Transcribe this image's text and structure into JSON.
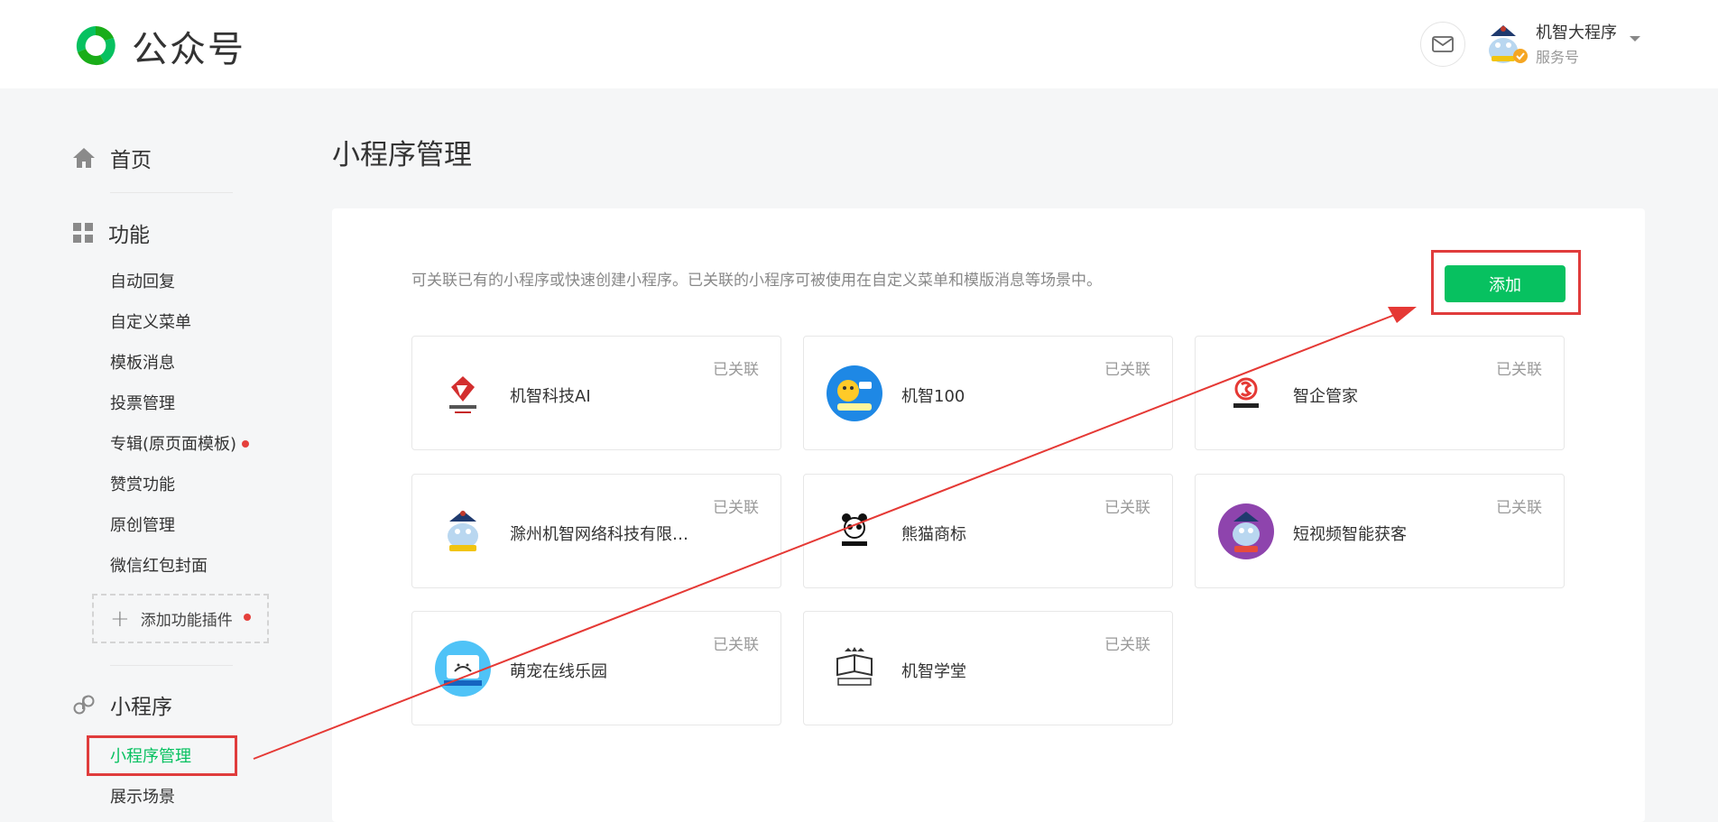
{
  "header": {
    "app_name": "公众号",
    "account_name": "机智大程序",
    "account_type": "服务号"
  },
  "sidebar": {
    "home": "首页",
    "features": {
      "label": "功能",
      "items": [
        "自动回复",
        "自定义菜单",
        "模板消息",
        "投票管理",
        "专辑(原页面模板)",
        "赞赏功能",
        "原创管理",
        "微信红包封面"
      ]
    },
    "add_plugin": "添加功能插件",
    "miniprogram": {
      "label": "小程序",
      "items": [
        "小程序管理",
        "展示场景"
      ]
    }
  },
  "main": {
    "title": "小程序管理",
    "description": "可关联已有的小程序或快速创建小程序。已关联的小程序可被使用在自定义菜单和模版消息等场景中。",
    "add_button": "添加",
    "cards": [
      {
        "name": "机智科技AI",
        "status": "已关联",
        "icon": "jizhi-keji-logo"
      },
      {
        "name": "机智100",
        "status": "已关联",
        "icon": "jizhi100-logo"
      },
      {
        "name": "智企管家",
        "status": "已关联",
        "icon": "zhiqi-guanjia-logo"
      },
      {
        "name": "滁州机智网络科技有限…",
        "status": "已关联",
        "icon": "chuzhou-jizhi-logo"
      },
      {
        "name": "熊猫商标",
        "status": "已关联",
        "icon": "panda-logo"
      },
      {
        "name": "短视频智能获客",
        "status": "已关联",
        "icon": "short-video-logo"
      },
      {
        "name": "萌宠在线乐园",
        "status": "已关联",
        "icon": "pet-logo"
      },
      {
        "name": "机智学堂",
        "status": "已关联",
        "icon": "jizhi-xuetang-logo"
      }
    ]
  },
  "colors": {
    "brand_green": "#07c160",
    "annotation_red": "#e03c3c",
    "badge_red": "#e5403c"
  }
}
